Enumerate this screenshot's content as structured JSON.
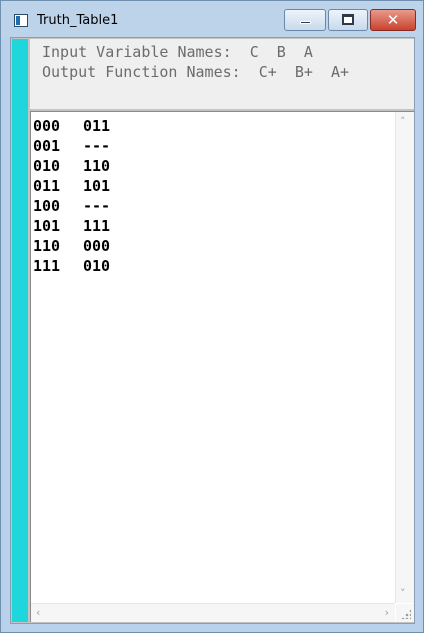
{
  "window": {
    "title": "Truth_Table1",
    "close_glyph": "✕"
  },
  "header": {
    "input_label": "Input Variable Names:",
    "input_names": "C  B  A",
    "output_label": "Output Function Names:",
    "output_names": "C+  B+  A+"
  },
  "truth_table": {
    "rows": [
      {
        "input": "000",
        "output": "011"
      },
      {
        "input": "001",
        "output": "---"
      },
      {
        "input": "010",
        "output": "110"
      },
      {
        "input": "011",
        "output": "101"
      },
      {
        "input": "100",
        "output": "---"
      },
      {
        "input": "101",
        "output": "111"
      },
      {
        "input": "110",
        "output": "000"
      },
      {
        "input": "111",
        "output": "010"
      }
    ]
  },
  "icons": {
    "app": "app-window-icon",
    "minimize": "minimize-icon",
    "maximize": "maximize-icon",
    "close": "close-icon",
    "scroll_up": "chevron-up-icon",
    "scroll_down": "chevron-down-icon",
    "scroll_left": "chevron-left-icon",
    "scroll_right": "chevron-right-icon",
    "size_grip": "resize-grip-icon"
  },
  "colors": {
    "titlebar": "#bdd3ea",
    "side_bar": "#1ed6dc",
    "header_panel": "#efefef",
    "header_text": "#6c6c6c",
    "close_button": "#c8432f"
  }
}
